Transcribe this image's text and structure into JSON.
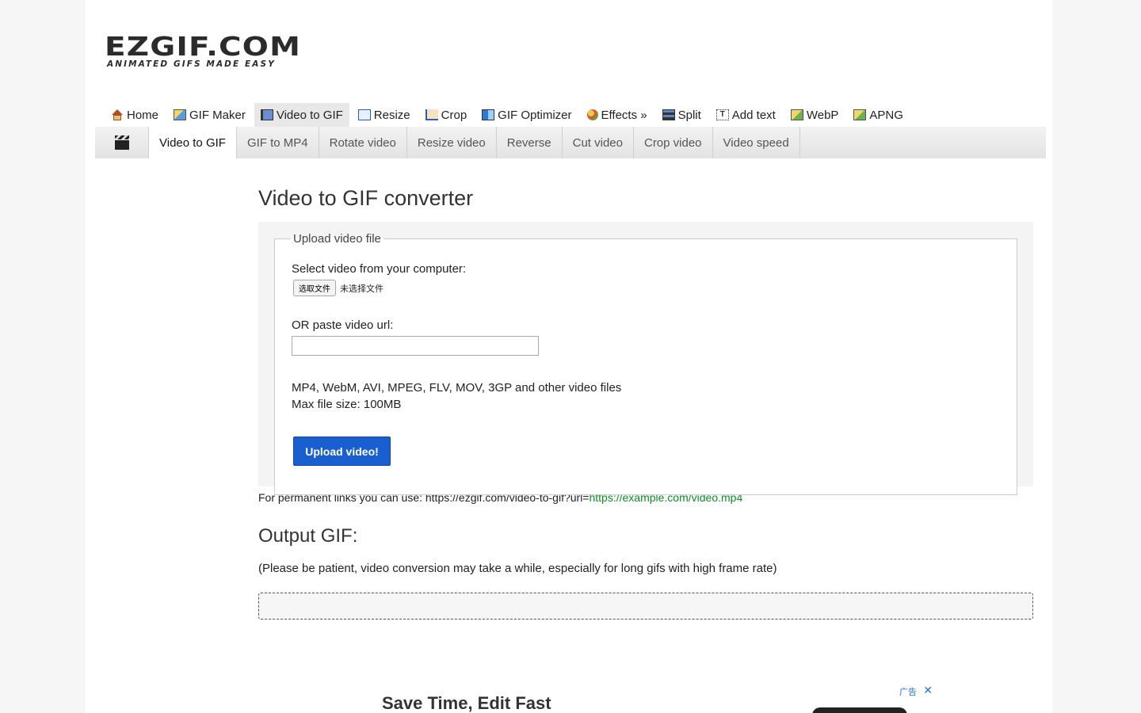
{
  "logo": {
    "main": "EZGIF.COM",
    "tagline": "ANIMATED GIFS MADE EASY"
  },
  "topnav": [
    {
      "label": "Home",
      "icon": "home-icon",
      "active": false
    },
    {
      "label": "GIF Maker",
      "icon": "image-icon",
      "active": false
    },
    {
      "label": "Video to GIF",
      "icon": "film-icon",
      "active": true
    },
    {
      "label": "Resize",
      "icon": "resize-icon",
      "active": false
    },
    {
      "label": "Crop",
      "icon": "crop-icon",
      "active": false
    },
    {
      "label": "GIF Optimizer",
      "icon": "optimizer-icon",
      "active": false
    },
    {
      "label": "Effects »",
      "icon": "effects-icon",
      "active": false
    },
    {
      "label": "Split",
      "icon": "split-icon",
      "active": false
    },
    {
      "label": "Add text",
      "icon": "text-icon",
      "active": false
    },
    {
      "label": "WebP",
      "icon": "webp-icon",
      "active": false
    },
    {
      "label": "APNG",
      "icon": "apng-icon",
      "active": false
    }
  ],
  "subnav": [
    {
      "label": "Video to GIF",
      "active": true
    },
    {
      "label": "GIF to MP4",
      "active": false
    },
    {
      "label": "Rotate video",
      "active": false
    },
    {
      "label": "Resize video",
      "active": false
    },
    {
      "label": "Reverse",
      "active": false
    },
    {
      "label": "Cut video",
      "active": false
    },
    {
      "label": "Crop video",
      "active": false
    },
    {
      "label": "Video speed",
      "active": false
    }
  ],
  "main": {
    "title": "Video to GIF converter",
    "fieldset_legend": "Upload video file",
    "select_label": "Select video from your computer:",
    "file_button": "选取文件",
    "file_status": "未选择文件",
    "url_label": "OR paste video url:",
    "url_value": "",
    "formats": "MP4, WebM, AVI, MPEG, FLV, MOV, 3GP and other video files",
    "max_size": "Max file size: 100MB",
    "upload_button": "Upload video!",
    "permalink_prefix": "For permanent links you can use: https://ezgif.com/video-to-gif?url=",
    "permalink_example": "https://example.com/video.mp4",
    "output_title": "Output GIF:",
    "patience_note": "(Please be patient, video conversion may take a while, especially for long gifs with high frame rate)"
  },
  "ad": {
    "headline": "Save Time, Edit Fast",
    "tag": "广告"
  },
  "colors": {
    "accent": "#1a5fd0",
    "link_green": "#0a8f22",
    "subnav_bg": "#e8e8e8"
  }
}
